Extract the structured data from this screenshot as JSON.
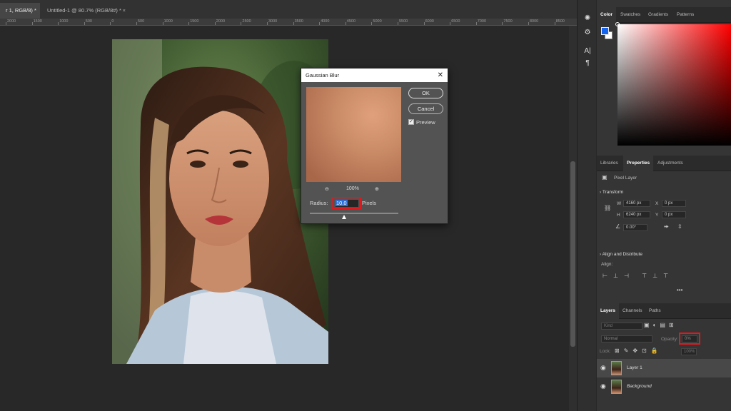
{
  "tabs": [
    {
      "label": "r 1, RGB/8) *"
    },
    {
      "label": "Untitled-1 @ 80.7% (RGB/8#) *"
    }
  ],
  "tab_close": "×",
  "ruler_labels": [
    "2000",
    "1500",
    "1000",
    "500",
    "0",
    "500",
    "1000",
    "1500",
    "2000",
    "2500",
    "3000",
    "3500",
    "4000",
    "4500",
    "5000",
    "5500",
    "6000",
    "6500",
    "7000",
    "7500",
    "8000",
    "8500"
  ],
  "right_panel": {
    "color_tabs": [
      "Color",
      "Swatches",
      "Gradients",
      "Patterns"
    ],
    "prop_tabs": [
      "Libraries",
      "Properties",
      "Adjustments"
    ],
    "pixel_layer": "Pixel Layer",
    "transform_title": "Transform",
    "w_label": "W",
    "w_value": "4160 px",
    "h_label": "H",
    "h_value": "6240 px",
    "x_label": "X",
    "x_value": "0 px",
    "y_label": "Y",
    "y_value": "0 px",
    "angle_value": "0.00°",
    "align_title": "Align and Distribute",
    "align_label": "Align:",
    "more": "•••",
    "layer_tabs": [
      "Layers",
      "Channels",
      "Paths"
    ],
    "kind_placeholder": "Kind",
    "blend_mode": "Normal",
    "opacity_label": "Opacity:",
    "opacity_value": "0%",
    "lock_label": "Lock:",
    "fill_value": "100%",
    "layers": [
      {
        "name": "Layer 1"
      },
      {
        "name": "Background"
      }
    ]
  },
  "dialog": {
    "title": "Gaussian Blur",
    "close": "✕",
    "ok": "OK",
    "cancel": "Cancel",
    "preview_label": "Preview",
    "preview_checked": "✓",
    "zoom_level": "100%",
    "zoom_out": "⊖",
    "zoom_in": "⊕",
    "radius_label": "Radius:",
    "radius_value": "10.0",
    "radius_unit": "Pixels"
  },
  "colors": {
    "foreground": "#1464f0",
    "highlight": "#e0191f"
  },
  "icons": [
    "close-icon",
    "eye-icon",
    "zoom-in-icon",
    "zoom-out-icon",
    "link-icon",
    "flip-horizontal-icon",
    "flip-vertical-icon",
    "type-tool-icon",
    "paragraph-icon",
    "brush-icon",
    "lock-icon"
  ]
}
